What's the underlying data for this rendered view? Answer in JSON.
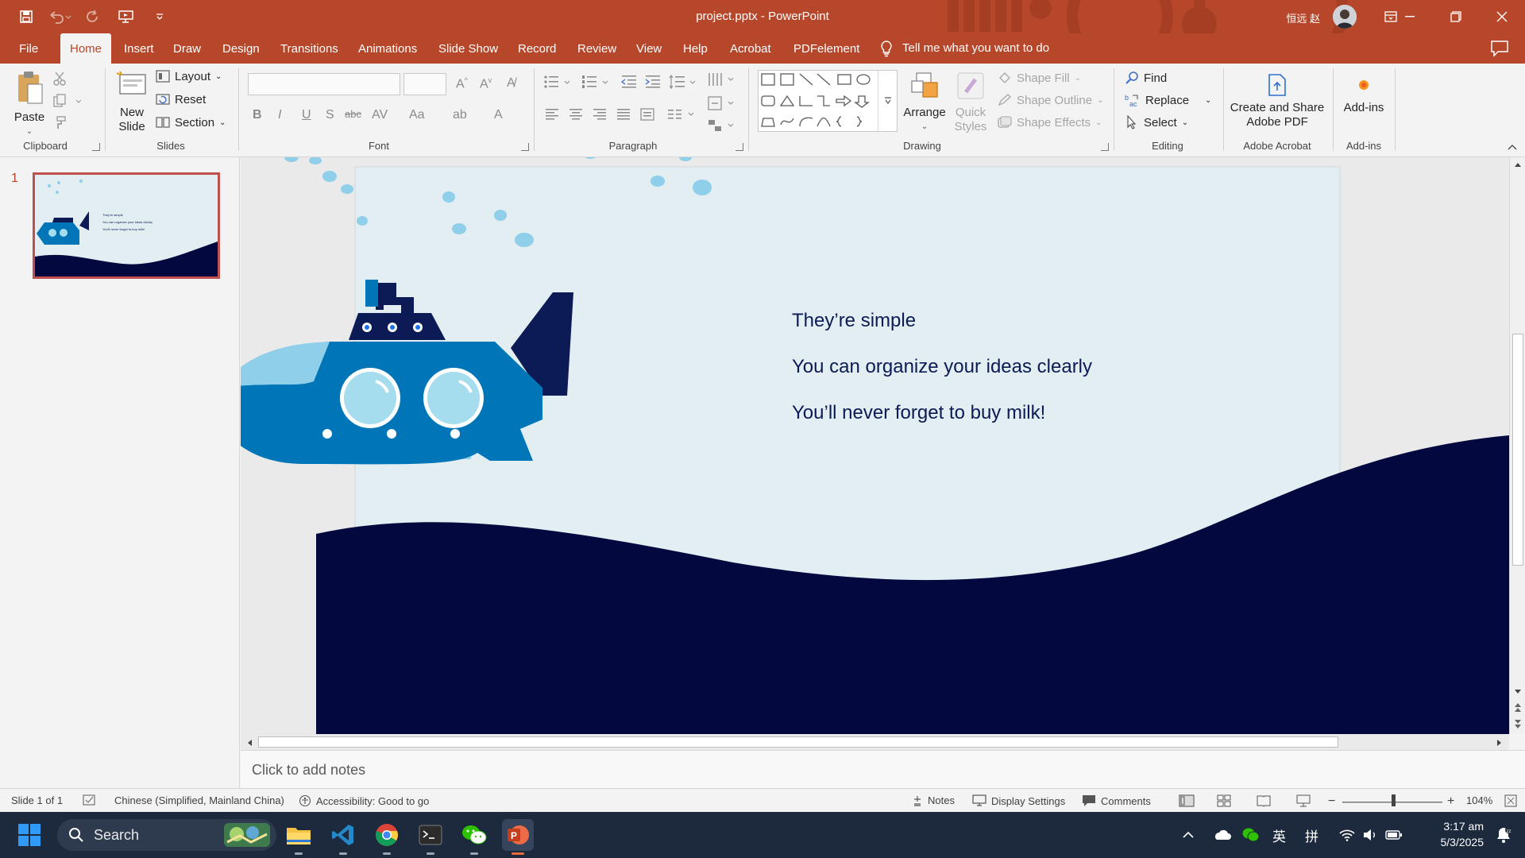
{
  "window": {
    "title": "project.pptx  -  PowerPoint",
    "user": "恒远 赵"
  },
  "tabs": [
    "File",
    "Home",
    "Insert",
    "Draw",
    "Design",
    "Transitions",
    "Animations",
    "Slide Show",
    "Record",
    "Review",
    "View",
    "Help",
    "Acrobat",
    "PDFelement"
  ],
  "active_tab": "Home",
  "tell_me": "Tell me what you want to do",
  "ribbon": {
    "clipboard": {
      "label": "Clipboard",
      "paste": "Paste"
    },
    "slides": {
      "label": "Slides",
      "new_slide_line1": "New",
      "new_slide_line2": "Slide",
      "layout": "Layout",
      "reset": "Reset",
      "section": "Section"
    },
    "font": {
      "label": "Font",
      "font_name": "",
      "font_size": ""
    },
    "paragraph": {
      "label": "Paragraph"
    },
    "drawing": {
      "label": "Drawing",
      "arrange": "Arrange",
      "quick_styles_line1": "Quick",
      "quick_styles_line2": "Styles",
      "shape_fill": "Shape Fill",
      "shape_outline": "Shape Outline",
      "shape_effects": "Shape Effects"
    },
    "editing": {
      "label": "Editing",
      "find": "Find",
      "replace": "Replace",
      "select": "Select"
    },
    "acrobat": {
      "label": "Adobe Acrobat",
      "create_line1": "Create and Share",
      "create_line2": "Adobe PDF"
    },
    "addins": {
      "label": "Add-ins",
      "button": "Add-ins"
    }
  },
  "thumbnails": [
    {
      "number": "1",
      "lines": [
        "They're simple",
        "You can organize your ideas clearly",
        "You'll never forget to buy milk!"
      ]
    }
  ],
  "slide": {
    "bullets": [
      "They’re simple",
      "You can organize your ideas clearly",
      "You’ll never forget to buy milk!"
    ],
    "colors": {
      "background": "#e2eef1",
      "wave": "#03083f",
      "hull": "#0076b9",
      "deck": "#0c1a55",
      "window": "#a5dcee",
      "fish": "#8fcfe9"
    }
  },
  "notes_placeholder": "Click to add notes",
  "status": {
    "slide_info": "Slide 1 of 1",
    "language": "Chinese (Simplified, Mainland China)",
    "accessibility": "Accessibility: Good to go",
    "notes": "Notes",
    "display_settings": "Display Settings",
    "comments": "Comments",
    "zoom": "104%"
  },
  "taskbar": {
    "search": "Search",
    "apps": [
      "file-explorer",
      "vscode",
      "chrome",
      "terminal",
      "wechat",
      "powerpoint"
    ],
    "tray": {
      "ime_lang": "英",
      "ime_mode": "拼"
    },
    "time": "3:17 am",
    "date": "5/3/2025"
  }
}
